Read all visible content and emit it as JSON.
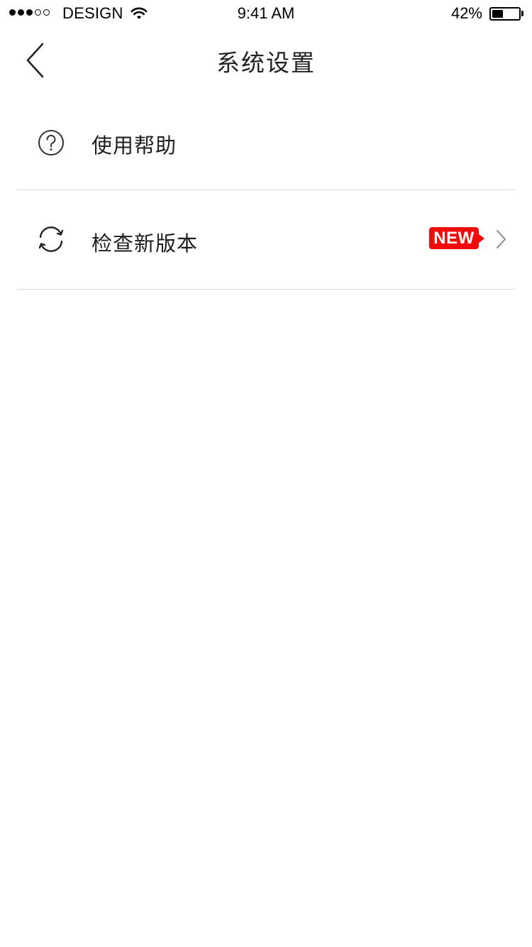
{
  "status_bar": {
    "carrier": "DESIGN",
    "time": "9:41 AM",
    "battery_percent": "42%",
    "battery_level": 0.42,
    "signal_bars_filled": 3,
    "signal_bars_total": 5
  },
  "nav": {
    "title": "系统设置",
    "back_icon": "chevron-left-icon"
  },
  "settings": {
    "items": [
      {
        "label": "使用帮助",
        "icon": "help-circle-icon"
      },
      {
        "label": "检查新版本",
        "icon": "refresh-icon",
        "badge": "NEW",
        "chevron_icon": "chevron-right-icon"
      }
    ]
  },
  "colors": {
    "badge_background": "#f10c0c",
    "divider": "#d9d9d9",
    "text": "#1e1e1e",
    "background": "#ffffff"
  }
}
